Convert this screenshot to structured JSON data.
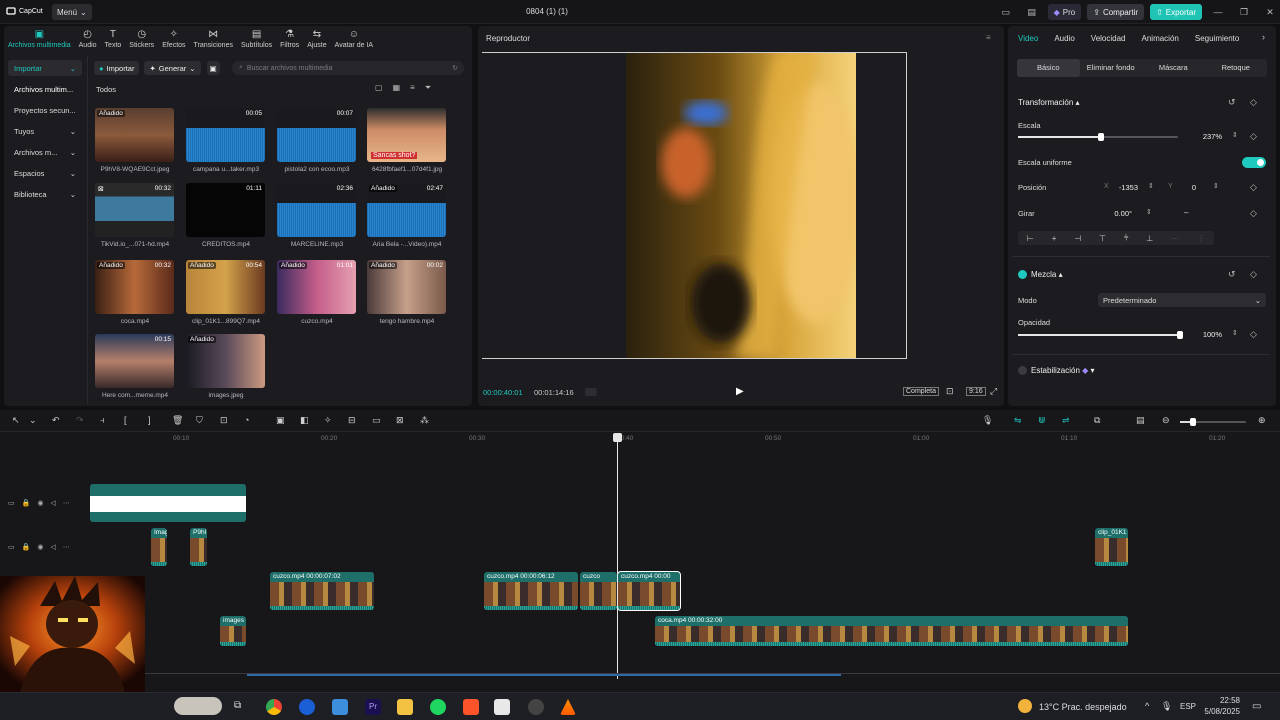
{
  "app": {
    "logo": "CapCut",
    "menu": "Menú",
    "doc_title": "0804 (1) (1)",
    "pro": "Pro",
    "share": "Compartir",
    "export": "Exportar"
  },
  "toolbar_tabs": [
    {
      "label": "Archivos multimedia",
      "icon": "media-icon"
    },
    {
      "label": "Audio",
      "icon": "audio-icon"
    },
    {
      "label": "Texto",
      "icon": "text-icon"
    },
    {
      "label": "Stickers",
      "icon": "sticker-icon"
    },
    {
      "label": "Efectos",
      "icon": "effects-icon"
    },
    {
      "label": "Transiciones",
      "icon": "transition-icon"
    },
    {
      "label": "Subtítulos",
      "icon": "subtitles-icon"
    },
    {
      "label": "Filtros",
      "icon": "filter-icon"
    },
    {
      "label": "Ajuste",
      "icon": "adjust-icon"
    },
    {
      "label": "Avatar de IA",
      "icon": "avatar-icon"
    }
  ],
  "sidenav": [
    "Importar",
    "Archivos multim...",
    "Proyectos secun...",
    "Tuyos",
    "Archivos m...",
    "Espacios",
    "Biblioteca"
  ],
  "media": {
    "import": "Importar",
    "generate": "Generar",
    "search_placeholder": "Buscar archivos multimedia",
    "all": "Todos",
    "items": [
      {
        "name": "P9hV8-WQAE9Cct.jpeg",
        "tag": "Añadido",
        "dur": ""
      },
      {
        "name": "campana u...taker.mp3",
        "tag": "",
        "dur": "00:05"
      },
      {
        "name": "pistola2 con ecoo.mp3",
        "tag": "",
        "dur": "00:07"
      },
      {
        "name": "6428fbfaef1...07d4f1.jpg",
        "tag": "",
        "dur": "",
        "overlay": "Sancas shot?"
      },
      {
        "name": "TikVid.io_...071-hd.mp4",
        "tag": "",
        "dur": "00:32"
      },
      {
        "name": "CREDITOS.mp4",
        "tag": "",
        "dur": "01:11"
      },
      {
        "name": "MARCELINE.mp3",
        "tag": "",
        "dur": "02:36"
      },
      {
        "name": "Aria Bela -...Video).mp4",
        "tag": "Añadido",
        "dur": "02:47"
      },
      {
        "name": "coca.mp4",
        "tag": "Añadido",
        "dur": "00:32"
      },
      {
        "name": "clip_01K1...899Q7.mp4",
        "tag": "Añadido",
        "dur": "00:54"
      },
      {
        "name": "cuzco.mp4",
        "tag": "Añadido",
        "dur": "01:01"
      },
      {
        "name": "tengo hambre.mp4",
        "tag": "Añadido",
        "dur": "00:02"
      },
      {
        "name": "Here com...meme.mp4",
        "tag": "",
        "dur": "00:15"
      },
      {
        "name": "images.jpeg",
        "tag": "Añadido",
        "dur": ""
      }
    ]
  },
  "player": {
    "title": "Reproductor",
    "current": "00:00:40:01",
    "total": "00:01:14:16",
    "full": "Completa",
    "ratio": "9:16"
  },
  "props": {
    "tabs": [
      "Video",
      "Audio",
      "Velocidad",
      "Animación",
      "Seguimiento"
    ],
    "subtabs": [
      "Básico",
      "Eliminar fondo",
      "Máscara",
      "Retoque"
    ],
    "transform": "Transformación",
    "scale_label": "Escala",
    "scale_value": "237%",
    "scale_level": 0.52,
    "uniform": "Escala uniforme",
    "position": "Posición",
    "pos_x_label": "X",
    "pos_x": "-1353",
    "pos_y_label": "Y",
    "pos_y": "0",
    "rotate": "Girar",
    "rotate_value": "0.00°",
    "rotate_dash": "–",
    "blend": "Mezcla",
    "mode": "Modo",
    "mode_value": "Predeterminado",
    "opacity": "Opacidad",
    "opacity_value": "100%",
    "opacity_level": 1.0,
    "stabilize": "Estabilización"
  },
  "timeline": {
    "ticks": [
      "00:10",
      "00:20",
      "00:30",
      "00:40",
      "00:50",
      "01:00",
      "01:10",
      "01:20"
    ],
    "clips": [
      {
        "label": "cuzco.mp4  00:00:07:02"
      },
      {
        "label": "cuzco.mp4  00:00:06:12"
      },
      {
        "label": "cuzco"
      },
      {
        "label": "cuzco.mp4  00:00"
      },
      {
        "label": "coca.mp4  00:00:32:00"
      },
      {
        "label": "Imag"
      },
      {
        "label": "P9hl"
      },
      {
        "label": "clip_01K1"
      },
      {
        "label": "images"
      }
    ]
  },
  "taskbar": {
    "weather": "13°C  Prac. despejado",
    "lang": "ESP",
    "time": "22:58",
    "date": "5/08/2025"
  }
}
